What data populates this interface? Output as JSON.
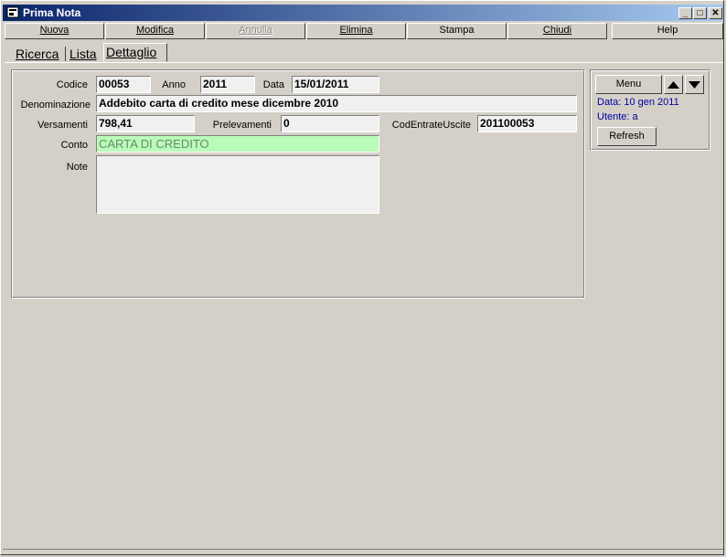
{
  "window": {
    "title": "Prima Nota"
  },
  "toolbar": {
    "nuova": "Nuova",
    "modifica": "Modifica",
    "annulla": "Annulla",
    "elimina": "Elimina",
    "stampa": "Stampa",
    "chiudi": "Chiudi",
    "help": "Help"
  },
  "tabs": [
    "Ricerca",
    "Lista",
    "Dettaglio"
  ],
  "form": {
    "codice_label": "Codice",
    "codice": "00053",
    "anno_label": "Anno",
    "anno": "2011",
    "data_label": "Data",
    "data": "15/01/2011",
    "denominazione_label": "Denominazione",
    "denominazione": "Addebito carta di credito mese dicembre 2010",
    "versamenti_label": "Versamenti",
    "versamenti": "798,41",
    "prelevamenti_label": "Prelevamenti",
    "prelevamenti": "0",
    "cod_label": "CodEntrateUscite",
    "cod": "201100053",
    "conto_label": "Conto",
    "conto": "CARTA DI CREDITO",
    "note_label": "Note",
    "note": ""
  },
  "side": {
    "menu": "Menu",
    "data_info": "Data: 10 gen 2011",
    "utente_info": "Utente: a",
    "refresh": "Refresh"
  },
  "colors": {
    "titlebar_start": "#0a246a",
    "titlebar_end": "#a6caf0",
    "conto_bg": "#b9fbb9",
    "info_text": "#0000a0"
  }
}
